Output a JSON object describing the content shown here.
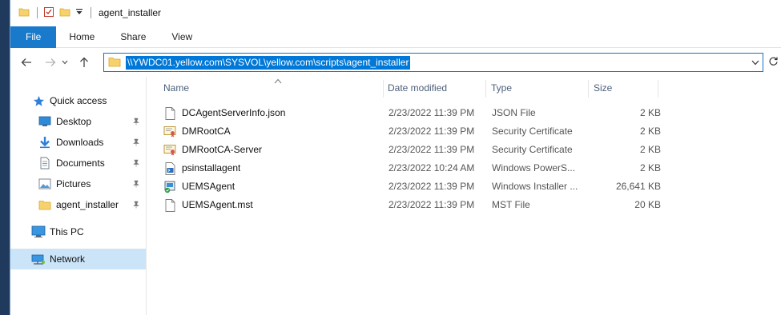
{
  "window": {
    "title": "agent_installer"
  },
  "ribbon": {
    "tabs": [
      "File",
      "Home",
      "Share",
      "View"
    ]
  },
  "address": {
    "path": "\\\\YWDC01.yellow.com\\SYSVOL\\yellow.com\\scripts\\agent_installer"
  },
  "sidebar": {
    "quick_access": "Quick access",
    "pinned": [
      {
        "label": "Desktop",
        "icon": "desktop-icon"
      },
      {
        "label": "Downloads",
        "icon": "download-icon"
      },
      {
        "label": "Documents",
        "icon": "documents-icon"
      },
      {
        "label": "Pictures",
        "icon": "pictures-icon"
      },
      {
        "label": "agent_installer",
        "icon": "folder-icon"
      }
    ],
    "this_pc": "This PC",
    "network": "Network"
  },
  "columns": {
    "name": "Name",
    "date": "Date modified",
    "type": "Type",
    "size": "Size"
  },
  "files": [
    {
      "name": "DCAgentServerInfo.json",
      "date": "2/23/2022 11:39 PM",
      "type": "JSON File",
      "size": "2 KB",
      "icon": "document-icon"
    },
    {
      "name": "DMRootCA",
      "date": "2/23/2022 11:39 PM",
      "type": "Security Certificate",
      "size": "2 KB",
      "icon": "certificate-icon"
    },
    {
      "name": "DMRootCA-Server",
      "date": "2/23/2022 11:39 PM",
      "type": "Security Certificate",
      "size": "2 KB",
      "icon": "certificate-icon"
    },
    {
      "name": "psinstallagent",
      "date": "2/23/2022 10:24 AM",
      "type": "Windows PowerS...",
      "size": "2 KB",
      "icon": "powershell-script-icon"
    },
    {
      "name": "UEMSAgent",
      "date": "2/23/2022 11:39 PM",
      "type": "Windows Installer ...",
      "size": "26,641 KB",
      "icon": "installer-icon"
    },
    {
      "name": "UEMSAgent.mst",
      "date": "2/23/2022 11:39 PM",
      "type": "MST File",
      "size": "20 KB",
      "icon": "document-icon"
    }
  ],
  "colors": {
    "accent": "#1979ca",
    "selection": "#0078d7",
    "nav_selected": "#cce4f7",
    "folder": "#f7d26c"
  }
}
